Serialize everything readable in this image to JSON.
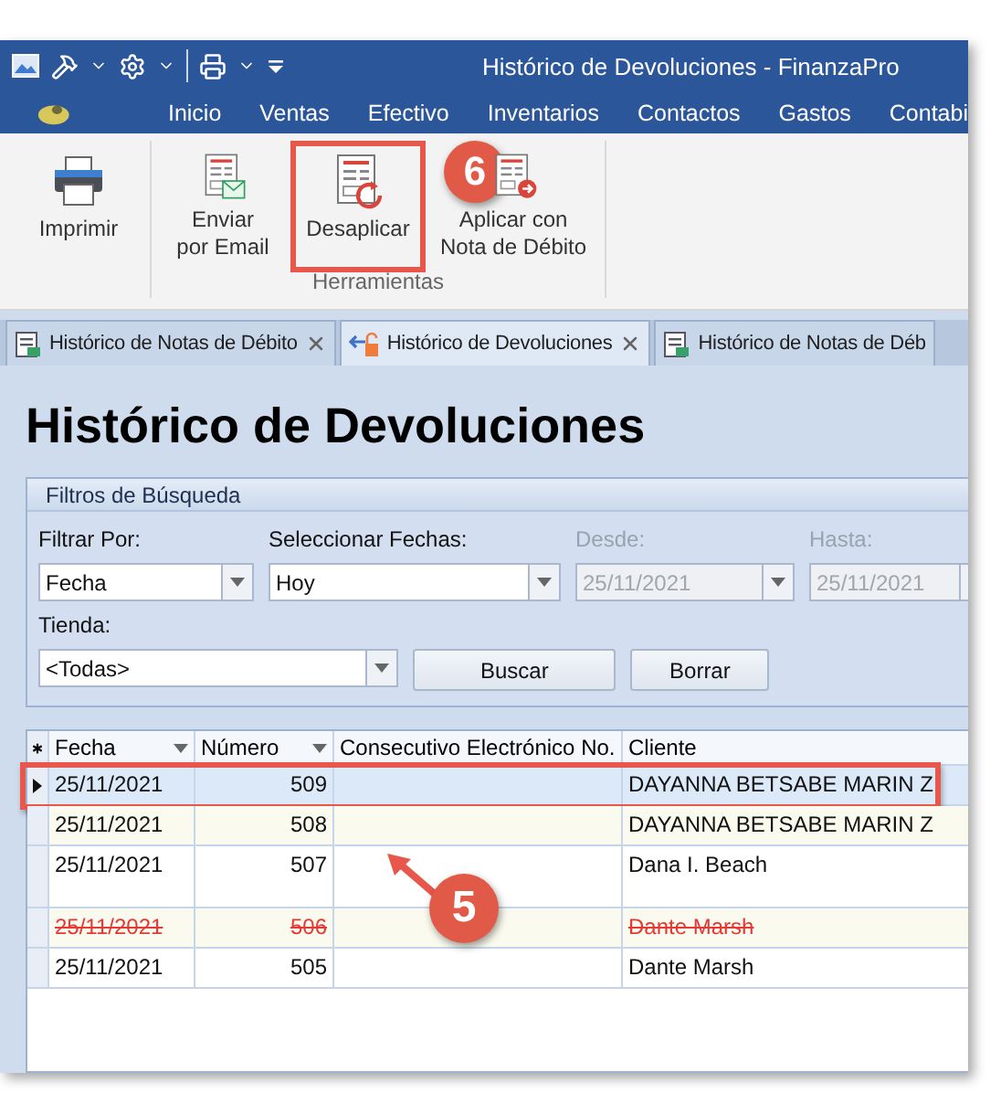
{
  "window": {
    "title": "Histórico de Devoluciones - FinanzaPro"
  },
  "ribbon_tabs": [
    "Inicio",
    "Ventas",
    "Efectivo",
    "Inventarios",
    "Contactos",
    "Gastos",
    "Contabi"
  ],
  "ribbon": {
    "groups": [
      {
        "buttons": [
          {
            "label": "Imprimir",
            "kind": "printer",
            "annotated": false
          }
        ]
      },
      {
        "label": "Herramientas",
        "buttons": [
          {
            "label": "Enviar\npor Email",
            "kind": "email",
            "annotated": false
          },
          {
            "label": "Desaplicar",
            "kind": "undo",
            "annotated": true,
            "callout": "6"
          },
          {
            "label": "Aplicar con\nNota de Débito",
            "kind": "apply",
            "annotated": false
          }
        ]
      }
    ]
  },
  "doc_tabs": [
    {
      "label": "Histórico de Notas de Débito",
      "kind": "doc",
      "closable": true,
      "selected": false
    },
    {
      "label": "Histórico de Devoluciones",
      "kind": "return",
      "closable": true,
      "selected": true
    },
    {
      "label": "Histórico de Notas de Déb",
      "kind": "doc",
      "closable": false,
      "selected": false
    }
  ],
  "page_title": "Histórico de Devoluciones",
  "filters": {
    "title": "Filtros de Búsqueda",
    "fields": [
      {
        "label": "Filtrar Por:",
        "value": "Fecha",
        "disabled": false
      },
      {
        "label": "Seleccionar Fechas:",
        "value": "Hoy",
        "disabled": false
      },
      {
        "label": "Desde:",
        "value": "25/11/2021",
        "disabled": true
      },
      {
        "label": "Hasta:",
        "value": "25/11/2021",
        "disabled": true
      }
    ],
    "store": {
      "label": "Tienda:",
      "value": "<Todas>"
    },
    "buttons": [
      "Buscar",
      "Borrar"
    ]
  },
  "table": {
    "callout": "5",
    "columns": [
      {
        "label": "Fecha",
        "sortable": true
      },
      {
        "label": "Número",
        "sortable": true
      },
      {
        "label": "Consecutivo Electrónico No.",
        "sortable": false
      },
      {
        "label": "Cliente",
        "sortable": false
      }
    ],
    "rows": [
      {
        "fecha": "25/11/2021",
        "numero": "509",
        "cliente": "DAYANNA BETSABE MARIN Z",
        "selected": true,
        "annotated": true,
        "voided": false
      },
      {
        "fecha": "25/11/2021",
        "numero": "508",
        "cliente": "DAYANNA BETSABE MARIN Z",
        "selected": false,
        "annotated": false,
        "voided": false
      },
      {
        "fecha": "25/11/2021",
        "numero": "507",
        "cliente": "Dana I. Beach",
        "selected": false,
        "annotated": false,
        "voided": false
      },
      {
        "fecha": "25/11/2021",
        "numero": "506",
        "cliente": "Dante Marsh",
        "selected": false,
        "annotated": false,
        "voided": true
      },
      {
        "fecha": "25/11/2021",
        "numero": "505",
        "cliente": "Dante Marsh",
        "selected": false,
        "annotated": false,
        "voided": false
      }
    ]
  }
}
